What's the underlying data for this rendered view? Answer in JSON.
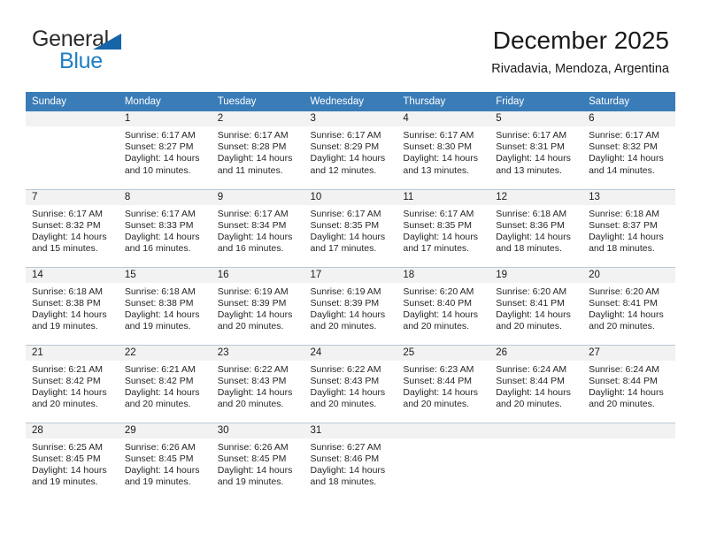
{
  "brand": {
    "name_part1": "General",
    "name_part2": "Blue",
    "flag_icon": "blue-triangle-flag-icon",
    "colors": {
      "general": "#2b2b2b",
      "blue": "#1f7fc4",
      "flag": "#1565a8"
    }
  },
  "header": {
    "title": "December 2025",
    "subtitle": "Rivadavia, Mendoza, Argentina"
  },
  "theme": {
    "header_row_bg": "#3a7cb8",
    "header_row_text": "#ffffff",
    "daynum_band_bg": "#f2f2f2",
    "cell_border": "#b9c8d6",
    "page_bg": "#ffffff"
  },
  "calendar": {
    "weekday_headers": [
      "Sunday",
      "Monday",
      "Tuesday",
      "Wednesday",
      "Thursday",
      "Friday",
      "Saturday"
    ],
    "weeks": [
      [
        {
          "day": "",
          "empty": true,
          "sunrise": "",
          "sunset": "",
          "daylight_line1": "",
          "daylight_line2": ""
        },
        {
          "day": "1",
          "empty": false,
          "sunrise": "Sunrise: 6:17 AM",
          "sunset": "Sunset: 8:27 PM",
          "daylight_line1": "Daylight: 14 hours",
          "daylight_line2": "and 10 minutes."
        },
        {
          "day": "2",
          "empty": false,
          "sunrise": "Sunrise: 6:17 AM",
          "sunset": "Sunset: 8:28 PM",
          "daylight_line1": "Daylight: 14 hours",
          "daylight_line2": "and 11 minutes."
        },
        {
          "day": "3",
          "empty": false,
          "sunrise": "Sunrise: 6:17 AM",
          "sunset": "Sunset: 8:29 PM",
          "daylight_line1": "Daylight: 14 hours",
          "daylight_line2": "and 12 minutes."
        },
        {
          "day": "4",
          "empty": false,
          "sunrise": "Sunrise: 6:17 AM",
          "sunset": "Sunset: 8:30 PM",
          "daylight_line1": "Daylight: 14 hours",
          "daylight_line2": "and 13 minutes."
        },
        {
          "day": "5",
          "empty": false,
          "sunrise": "Sunrise: 6:17 AM",
          "sunset": "Sunset: 8:31 PM",
          "daylight_line1": "Daylight: 14 hours",
          "daylight_line2": "and 13 minutes."
        },
        {
          "day": "6",
          "empty": false,
          "sunrise": "Sunrise: 6:17 AM",
          "sunset": "Sunset: 8:32 PM",
          "daylight_line1": "Daylight: 14 hours",
          "daylight_line2": "and 14 minutes."
        }
      ],
      [
        {
          "day": "7",
          "empty": false,
          "sunrise": "Sunrise: 6:17 AM",
          "sunset": "Sunset: 8:32 PM",
          "daylight_line1": "Daylight: 14 hours",
          "daylight_line2": "and 15 minutes."
        },
        {
          "day": "8",
          "empty": false,
          "sunrise": "Sunrise: 6:17 AM",
          "sunset": "Sunset: 8:33 PM",
          "daylight_line1": "Daylight: 14 hours",
          "daylight_line2": "and 16 minutes."
        },
        {
          "day": "9",
          "empty": false,
          "sunrise": "Sunrise: 6:17 AM",
          "sunset": "Sunset: 8:34 PM",
          "daylight_line1": "Daylight: 14 hours",
          "daylight_line2": "and 16 minutes."
        },
        {
          "day": "10",
          "empty": false,
          "sunrise": "Sunrise: 6:17 AM",
          "sunset": "Sunset: 8:35 PM",
          "daylight_line1": "Daylight: 14 hours",
          "daylight_line2": "and 17 minutes."
        },
        {
          "day": "11",
          "empty": false,
          "sunrise": "Sunrise: 6:17 AM",
          "sunset": "Sunset: 8:35 PM",
          "daylight_line1": "Daylight: 14 hours",
          "daylight_line2": "and 17 minutes."
        },
        {
          "day": "12",
          "empty": false,
          "sunrise": "Sunrise: 6:18 AM",
          "sunset": "Sunset: 8:36 PM",
          "daylight_line1": "Daylight: 14 hours",
          "daylight_line2": "and 18 minutes."
        },
        {
          "day": "13",
          "empty": false,
          "sunrise": "Sunrise: 6:18 AM",
          "sunset": "Sunset: 8:37 PM",
          "daylight_line1": "Daylight: 14 hours",
          "daylight_line2": "and 18 minutes."
        }
      ],
      [
        {
          "day": "14",
          "empty": false,
          "sunrise": "Sunrise: 6:18 AM",
          "sunset": "Sunset: 8:38 PM",
          "daylight_line1": "Daylight: 14 hours",
          "daylight_line2": "and 19 minutes."
        },
        {
          "day": "15",
          "empty": false,
          "sunrise": "Sunrise: 6:18 AM",
          "sunset": "Sunset: 8:38 PM",
          "daylight_line1": "Daylight: 14 hours",
          "daylight_line2": "and 19 minutes."
        },
        {
          "day": "16",
          "empty": false,
          "sunrise": "Sunrise: 6:19 AM",
          "sunset": "Sunset: 8:39 PM",
          "daylight_line1": "Daylight: 14 hours",
          "daylight_line2": "and 20 minutes."
        },
        {
          "day": "17",
          "empty": false,
          "sunrise": "Sunrise: 6:19 AM",
          "sunset": "Sunset: 8:39 PM",
          "daylight_line1": "Daylight: 14 hours",
          "daylight_line2": "and 20 minutes."
        },
        {
          "day": "18",
          "empty": false,
          "sunrise": "Sunrise: 6:20 AM",
          "sunset": "Sunset: 8:40 PM",
          "daylight_line1": "Daylight: 14 hours",
          "daylight_line2": "and 20 minutes."
        },
        {
          "day": "19",
          "empty": false,
          "sunrise": "Sunrise: 6:20 AM",
          "sunset": "Sunset: 8:41 PM",
          "daylight_line1": "Daylight: 14 hours",
          "daylight_line2": "and 20 minutes."
        },
        {
          "day": "20",
          "empty": false,
          "sunrise": "Sunrise: 6:20 AM",
          "sunset": "Sunset: 8:41 PM",
          "daylight_line1": "Daylight: 14 hours",
          "daylight_line2": "and 20 minutes."
        }
      ],
      [
        {
          "day": "21",
          "empty": false,
          "sunrise": "Sunrise: 6:21 AM",
          "sunset": "Sunset: 8:42 PM",
          "daylight_line1": "Daylight: 14 hours",
          "daylight_line2": "and 20 minutes."
        },
        {
          "day": "22",
          "empty": false,
          "sunrise": "Sunrise: 6:21 AM",
          "sunset": "Sunset: 8:42 PM",
          "daylight_line1": "Daylight: 14 hours",
          "daylight_line2": "and 20 minutes."
        },
        {
          "day": "23",
          "empty": false,
          "sunrise": "Sunrise: 6:22 AM",
          "sunset": "Sunset: 8:43 PM",
          "daylight_line1": "Daylight: 14 hours",
          "daylight_line2": "and 20 minutes."
        },
        {
          "day": "24",
          "empty": false,
          "sunrise": "Sunrise: 6:22 AM",
          "sunset": "Sunset: 8:43 PM",
          "daylight_line1": "Daylight: 14 hours",
          "daylight_line2": "and 20 minutes."
        },
        {
          "day": "25",
          "empty": false,
          "sunrise": "Sunrise: 6:23 AM",
          "sunset": "Sunset: 8:44 PM",
          "daylight_line1": "Daylight: 14 hours",
          "daylight_line2": "and 20 minutes."
        },
        {
          "day": "26",
          "empty": false,
          "sunrise": "Sunrise: 6:24 AM",
          "sunset": "Sunset: 8:44 PM",
          "daylight_line1": "Daylight: 14 hours",
          "daylight_line2": "and 20 minutes."
        },
        {
          "day": "27",
          "empty": false,
          "sunrise": "Sunrise: 6:24 AM",
          "sunset": "Sunset: 8:44 PM",
          "daylight_line1": "Daylight: 14 hours",
          "daylight_line2": "and 20 minutes."
        }
      ],
      [
        {
          "day": "28",
          "empty": false,
          "sunrise": "Sunrise: 6:25 AM",
          "sunset": "Sunset: 8:45 PM",
          "daylight_line1": "Daylight: 14 hours",
          "daylight_line2": "and 19 minutes."
        },
        {
          "day": "29",
          "empty": false,
          "sunrise": "Sunrise: 6:26 AM",
          "sunset": "Sunset: 8:45 PM",
          "daylight_line1": "Daylight: 14 hours",
          "daylight_line2": "and 19 minutes."
        },
        {
          "day": "30",
          "empty": false,
          "sunrise": "Sunrise: 6:26 AM",
          "sunset": "Sunset: 8:45 PM",
          "daylight_line1": "Daylight: 14 hours",
          "daylight_line2": "and 19 minutes."
        },
        {
          "day": "31",
          "empty": false,
          "sunrise": "Sunrise: 6:27 AM",
          "sunset": "Sunset: 8:46 PM",
          "daylight_line1": "Daylight: 14 hours",
          "daylight_line2": "and 18 minutes."
        },
        {
          "day": "",
          "empty": true,
          "sunrise": "",
          "sunset": "",
          "daylight_line1": "",
          "daylight_line2": ""
        },
        {
          "day": "",
          "empty": true,
          "sunrise": "",
          "sunset": "",
          "daylight_line1": "",
          "daylight_line2": ""
        },
        {
          "day": "",
          "empty": true,
          "sunrise": "",
          "sunset": "",
          "daylight_line1": "",
          "daylight_line2": ""
        }
      ]
    ]
  }
}
